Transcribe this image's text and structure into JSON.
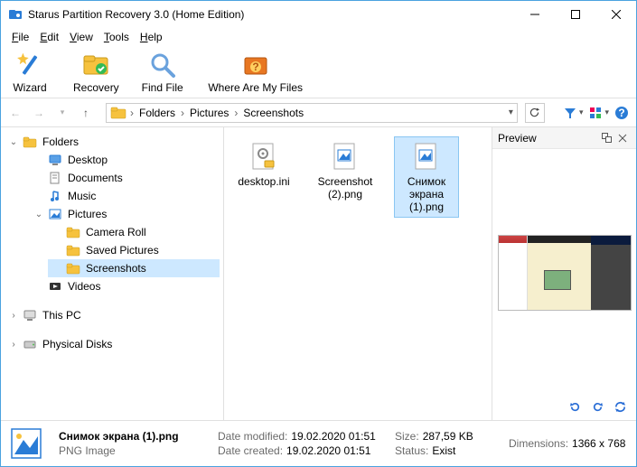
{
  "window": {
    "title": "Starus Partition Recovery 3.0 (Home Edition)"
  },
  "menu": {
    "file": "File",
    "edit": "Edit",
    "view": "View",
    "tools": "Tools",
    "help": "Help"
  },
  "toolbar": {
    "wizard": "Wizard",
    "recovery": "Recovery",
    "findfile": "Find File",
    "where": "Where Are My Files"
  },
  "breadcrumb": {
    "c1": "Folders",
    "c2": "Pictures",
    "c3": "Screenshots"
  },
  "tree": {
    "folders": "Folders",
    "desktop": "Desktop",
    "documents": "Documents",
    "music": "Music",
    "pictures": "Pictures",
    "camera_roll": "Camera Roll",
    "saved_pictures": "Saved Pictures",
    "screenshots": "Screenshots",
    "videos": "Videos",
    "this_pc": "This PC",
    "physical_disks": "Physical Disks"
  },
  "files": {
    "f1": "desktop.ini",
    "f2": "Screenshot (2).png",
    "f3": "Снимок экрана (1).png"
  },
  "preview": {
    "title": "Preview"
  },
  "details": {
    "name": "Снимок экрана (1).png",
    "type": "PNG Image",
    "date_modified_label": "Date modified:",
    "date_modified": "19.02.2020 01:51",
    "date_created_label": "Date created:",
    "date_created": "19.02.2020 01:51",
    "size_label": "Size:",
    "size": "287,59 KB",
    "status_label": "Status:",
    "status": "Exist",
    "dimensions_label": "Dimensions:",
    "dimensions": "1366 x 768"
  }
}
